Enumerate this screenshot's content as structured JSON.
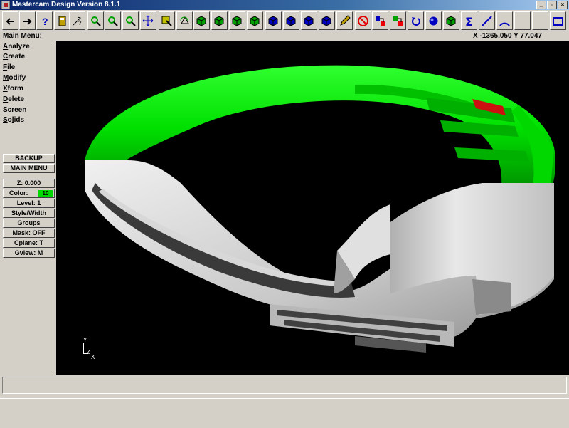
{
  "window": {
    "title": "Mastercam Design Version 8.1.1"
  },
  "window_controls": [
    "minimize",
    "restore",
    "close"
  ],
  "toolbar": {
    "buttons": [
      {
        "name": "back-arrow-icon",
        "color": "#000000"
      },
      {
        "name": "forward-arrow-icon",
        "color": "#000000"
      },
      {
        "name": "help-icon",
        "color": "#0000c0"
      },
      {
        "name": "calculator-icon",
        "color": "#c0a000"
      },
      {
        "name": "analyze-icon",
        "color": "#000000"
      },
      {
        "name": "zoom-window-icon",
        "color": "#00a000"
      },
      {
        "name": "zoom-in-icon",
        "color": "#00a000"
      },
      {
        "name": "zoom-out-icon",
        "color": "#00a000"
      },
      {
        "name": "pan-icon",
        "color": "#0000c0"
      },
      {
        "name": "select-icon",
        "color": "#c0c000"
      },
      {
        "name": "rotate-view-icon",
        "color": "#000000"
      },
      {
        "name": "iso-view-icon",
        "color": "#00a000"
      },
      {
        "name": "top-view-icon",
        "color": "#00a000"
      },
      {
        "name": "front-view-icon",
        "color": "#00a000"
      },
      {
        "name": "side-view-icon",
        "color": "#00a000"
      },
      {
        "name": "cube-view-icon",
        "color": "#0000c0"
      },
      {
        "name": "cube-view-2-icon",
        "color": "#0000c0"
      },
      {
        "name": "cube-view-3-icon",
        "color": "#0000c0"
      },
      {
        "name": "cube-view-4-icon",
        "color": "#0000c0"
      },
      {
        "name": "pencil-icon",
        "color": "#c0a000"
      },
      {
        "name": "no-entry-icon",
        "color": "#e00000"
      },
      {
        "name": "transform-icon",
        "color": "#0000c0"
      },
      {
        "name": "transform-2-icon",
        "color": "#00a000"
      },
      {
        "name": "undo-icon",
        "color": "#0000c0"
      },
      {
        "name": "sphere-icon",
        "color": "#0000c0"
      },
      {
        "name": "layers-icon",
        "color": "#00a000"
      },
      {
        "name": "sum-icon",
        "color": "#0000c0"
      },
      {
        "name": "line-icon",
        "color": "#0000c0"
      },
      {
        "name": "arc-icon",
        "color": "#0000c0"
      },
      {
        "name": "fillet-icon",
        "color": "#0000c0"
      },
      {
        "name": "spline-icon",
        "color": "#0000c0"
      },
      {
        "name": "rectangle-icon",
        "color": "#0000c0"
      }
    ]
  },
  "status": {
    "menu_title": "Main Menu:",
    "coords": "X -1365.050  Y 77.047"
  },
  "main_menu": {
    "items": [
      {
        "key": "A",
        "rest": "nalyze"
      },
      {
        "key": "C",
        "rest": "reate"
      },
      {
        "key": "F",
        "rest": "ile"
      },
      {
        "key": "M",
        "rest": "odify"
      },
      {
        "key": "X",
        "rest": "form"
      },
      {
        "key": "D",
        "rest": "elete"
      },
      {
        "key": "S",
        "rest": "creen"
      },
      {
        "key": "S",
        "rest": "o",
        "key2": "l",
        "rest2": "ids"
      }
    ],
    "backup": "BACKUP",
    "main_menu": "MAIN MENU"
  },
  "secondary_menu": {
    "z": "Z:  0.000",
    "color_label": "Color:",
    "color_value": "10",
    "color_swatch": "#00d800",
    "level": "Level:  1",
    "style_width": "Style/Width",
    "groups": "Groups",
    "mask": "Mask:  OFF",
    "cplane": "Cplane:  T",
    "gview": "Gview:  M"
  },
  "axes": {
    "y": "Y",
    "z": "Z",
    "x": "X"
  },
  "model_colors": {
    "green": "#00e000",
    "red": "#cc1010",
    "grey": "#c8c8c8",
    "background": "#000000"
  }
}
